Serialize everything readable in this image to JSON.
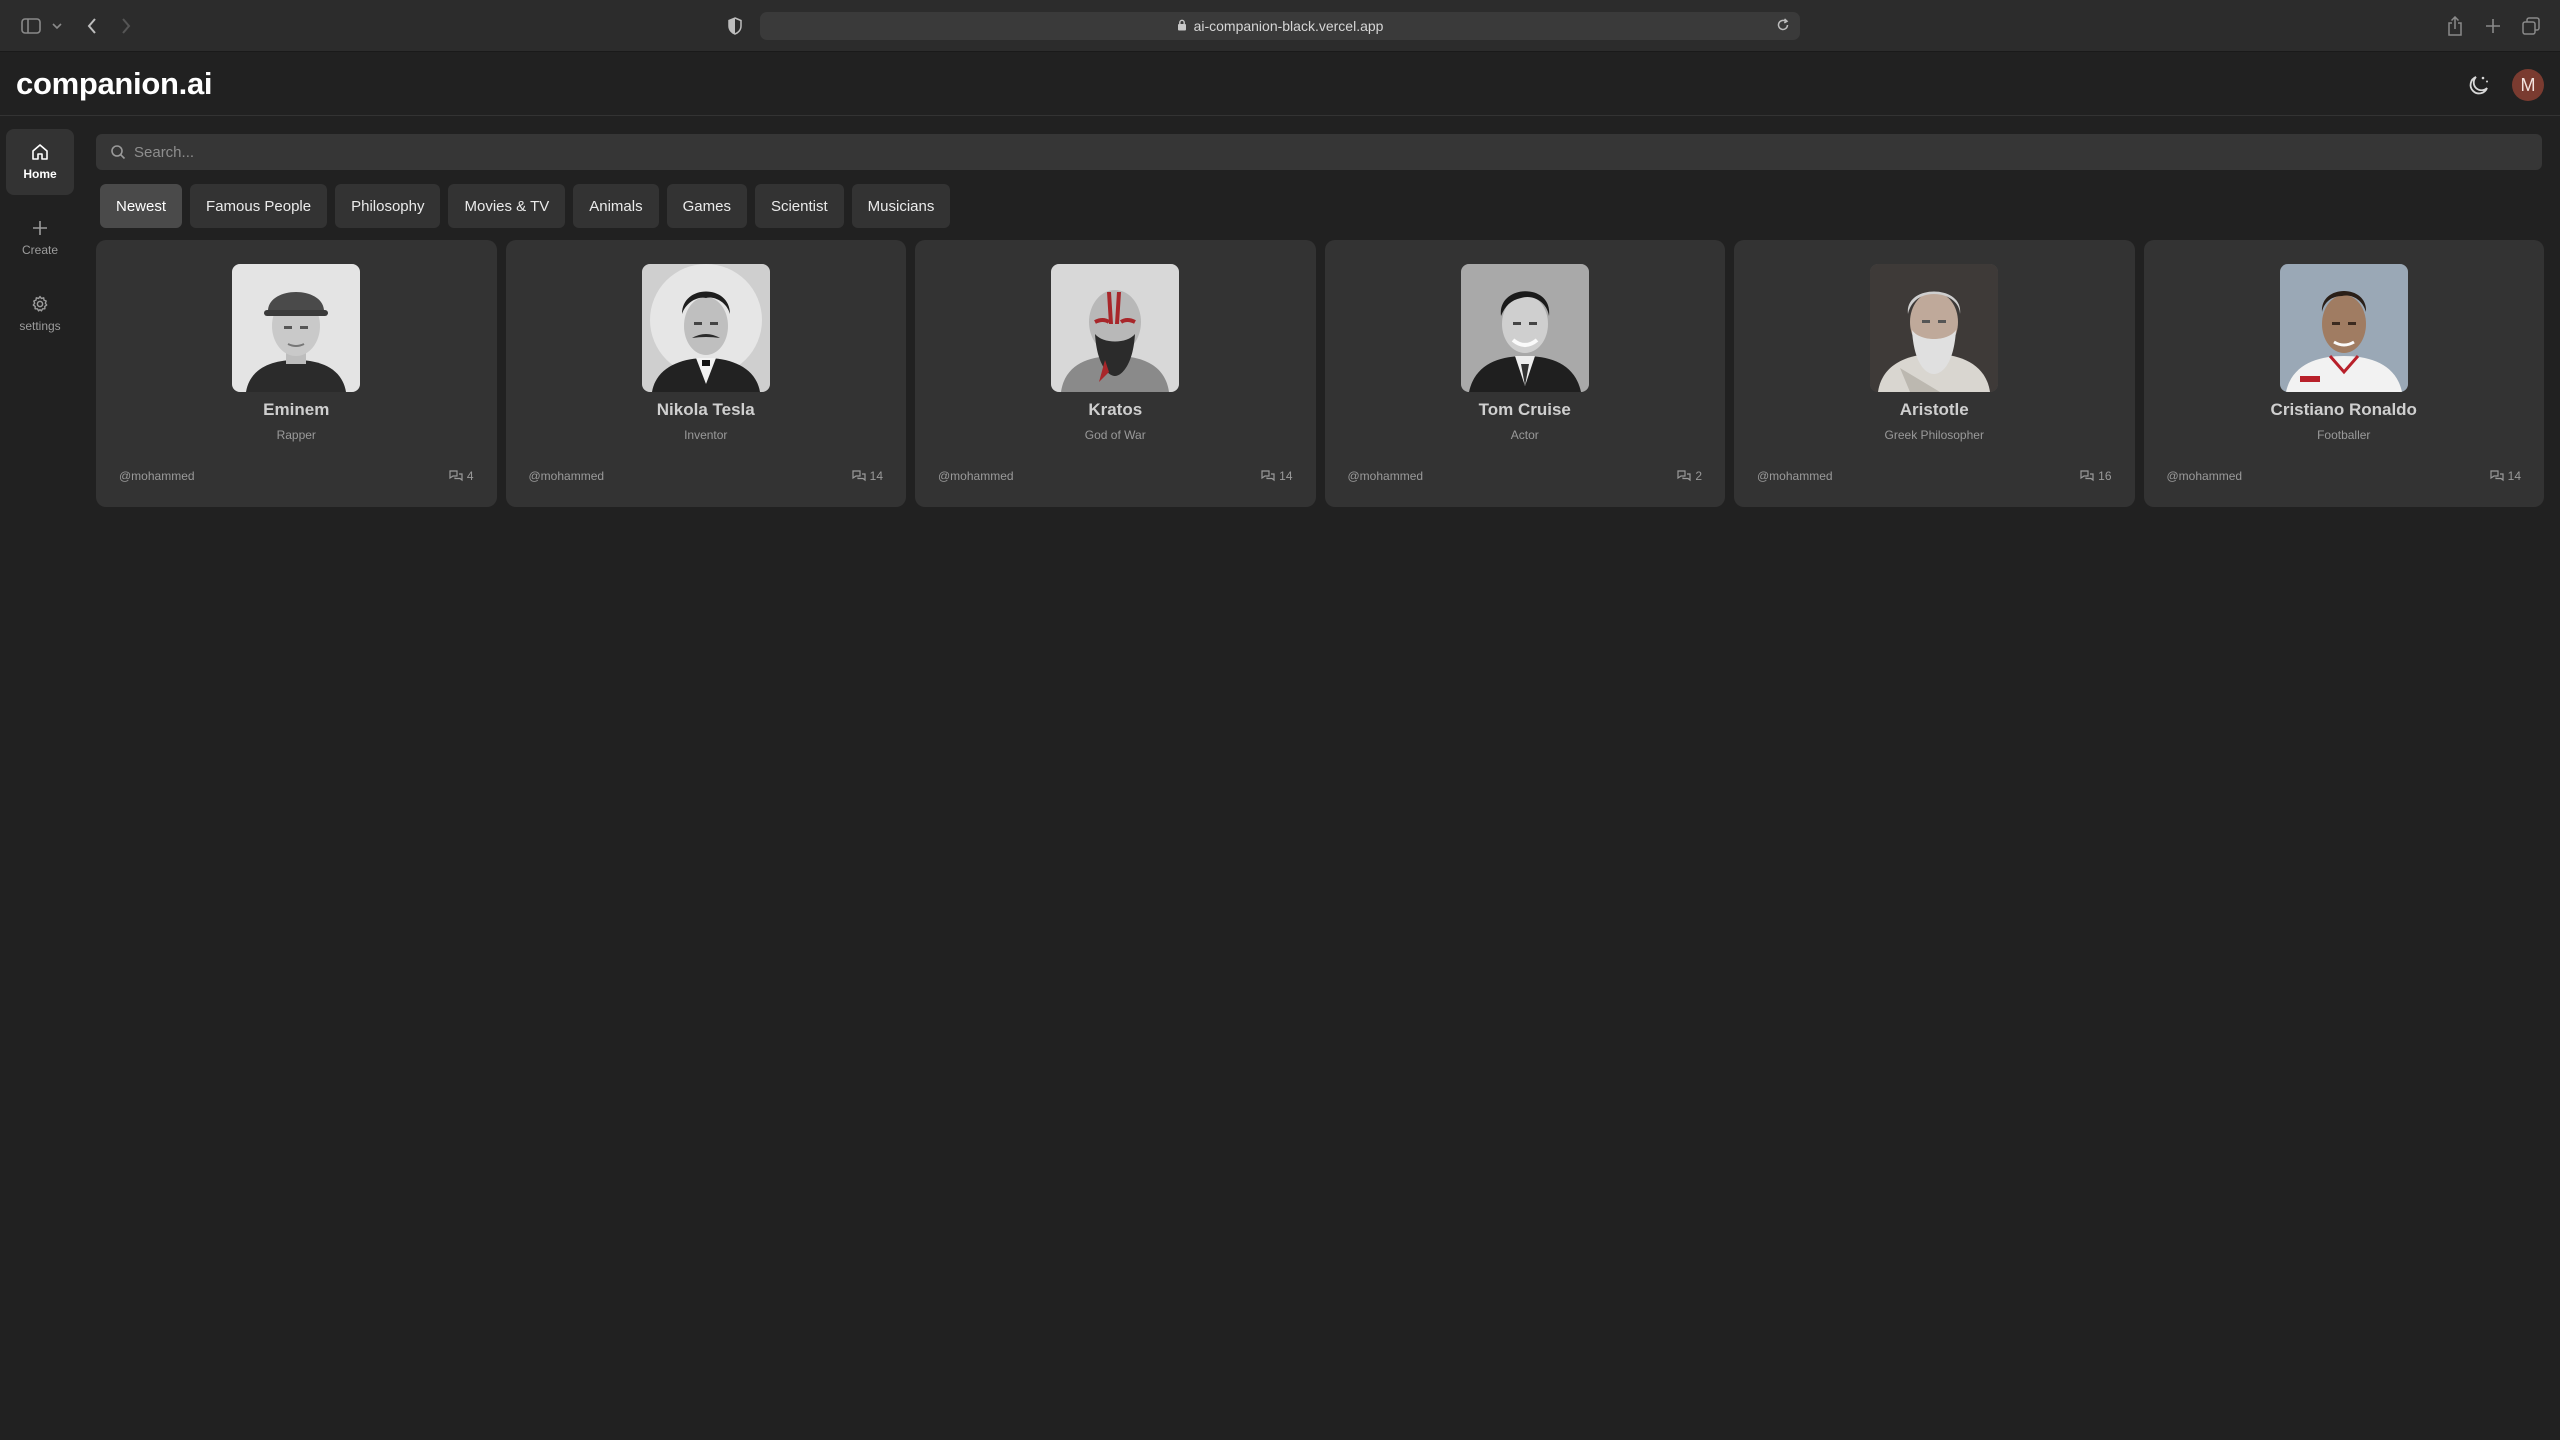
{
  "browser": {
    "url": "ai-companion-black.vercel.app"
  },
  "app": {
    "logo": "companion.ai",
    "avatar_initial": "M"
  },
  "sidebar": {
    "items": [
      {
        "label": "Home",
        "icon": "home-icon",
        "active": true
      },
      {
        "label": "Create",
        "icon": "plus-icon",
        "active": false
      },
      {
        "label": "settings",
        "icon": "gear-icon",
        "active": false
      }
    ]
  },
  "search": {
    "placeholder": "Search..."
  },
  "categories": [
    {
      "label": "Newest",
      "active": true
    },
    {
      "label": "Famous People",
      "active": false
    },
    {
      "label": "Philosophy",
      "active": false
    },
    {
      "label": "Movies & TV",
      "active": false
    },
    {
      "label": "Animals",
      "active": false
    },
    {
      "label": "Games",
      "active": false
    },
    {
      "label": "Scientist",
      "active": false
    },
    {
      "label": "Musicians",
      "active": false
    }
  ],
  "companions": [
    {
      "name": "Eminem",
      "description": "Rapper",
      "user": "@mohammed",
      "count": "4"
    },
    {
      "name": "Nikola Tesla",
      "description": "Inventor",
      "user": "@mohammed",
      "count": "14"
    },
    {
      "name": "Kratos",
      "description": "God of War",
      "user": "@mohammed",
      "count": "14"
    },
    {
      "name": "Tom Cruise",
      "description": "Actor",
      "user": "@mohammed",
      "count": "2"
    },
    {
      "name": "Aristotle",
      "description": "Greek Philosopher",
      "user": "@mohammed",
      "count": "16"
    },
    {
      "name": "Cristiano Ronaldo",
      "description": "Footballer",
      "user": "@mohammed",
      "count": "14"
    }
  ]
}
